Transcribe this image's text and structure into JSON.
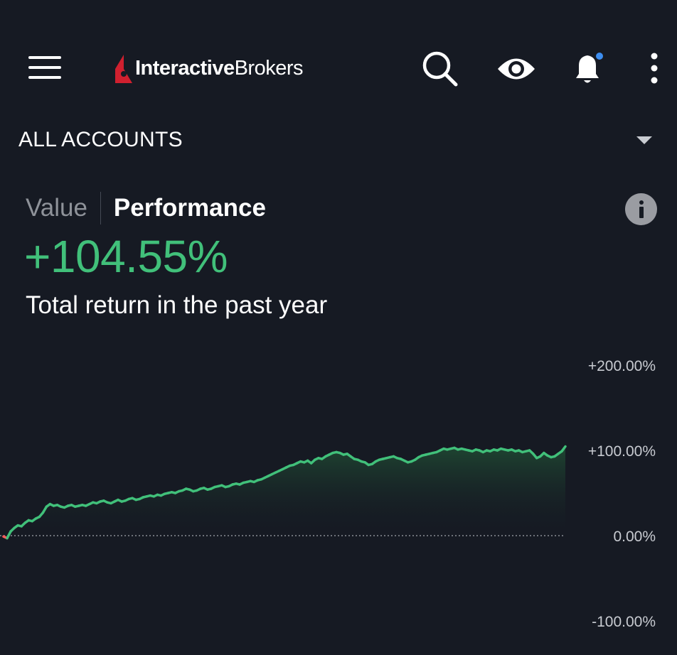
{
  "header": {
    "logo": {
      "bold": "Interactive",
      "light": "Brokers",
      "mark_color": "#d0202f"
    },
    "icons": [
      "menu-icon",
      "search-icon",
      "eye-icon",
      "bell-icon",
      "more-vertical-icon"
    ],
    "notification_dot_color": "#3d8ef0"
  },
  "account_selector": {
    "label": "ALL ACCOUNTS"
  },
  "tabs": [
    {
      "label": "Value",
      "active": false
    },
    {
      "label": "Performance",
      "active": true
    }
  ],
  "summary": {
    "return_value": "+104.55%",
    "caption": "Total return in the past year",
    "positive_color": "#41c07a",
    "negative_color": "#ff5b5b"
  },
  "chart_data": {
    "type": "area",
    "title": "",
    "xlabel": "",
    "ylabel": "",
    "y_tick_labels": [
      "+200.00%",
      "+100.00%",
      "0.00%",
      "-100.00%"
    ],
    "y_ticks": [
      200,
      100,
      0,
      -100
    ],
    "ylim": [
      -100,
      200
    ],
    "baseline": 0,
    "grid": false,
    "series": [
      {
        "values": [
          -1,
          -3,
          5,
          9,
          12,
          11,
          15,
          18,
          17,
          20,
          22,
          27,
          34,
          37,
          35,
          36,
          34,
          33,
          35,
          36,
          34,
          35,
          36,
          35,
          37,
          39,
          38,
          40,
          41,
          39,
          38,
          40,
          42,
          40,
          41,
          43,
          44,
          42,
          43,
          45,
          46,
          47,
          46,
          48,
          47,
          49,
          50,
          51,
          50,
          52,
          53,
          55,
          54,
          52,
          53,
          55,
          56,
          54,
          55,
          57,
          58,
          59,
          57,
          58,
          60,
          61,
          60,
          62,
          63,
          64,
          63,
          65,
          66,
          68,
          70,
          72,
          74,
          76,
          78,
          80,
          82,
          83,
          85,
          87,
          86,
          88,
          85,
          89,
          91,
          90,
          93,
          95,
          97,
          98,
          97,
          95,
          96,
          93,
          90,
          89,
          87,
          86,
          83,
          84,
          87,
          89,
          90,
          91,
          92,
          93,
          91,
          90,
          88,
          86,
          87,
          89,
          92,
          94,
          95,
          96,
          97,
          98,
          100,
          102,
          101,
          102,
          103,
          101,
          102,
          101,
          100,
          99,
          101,
          100,
          98,
          100,
          99,
          101,
          100,
          102,
          101,
          100,
          101,
          99,
          100,
          98,
          99,
          100,
          96,
          91,
          93,
          97,
          94,
          92,
          93,
          96,
          99,
          104.55
        ]
      }
    ]
  }
}
